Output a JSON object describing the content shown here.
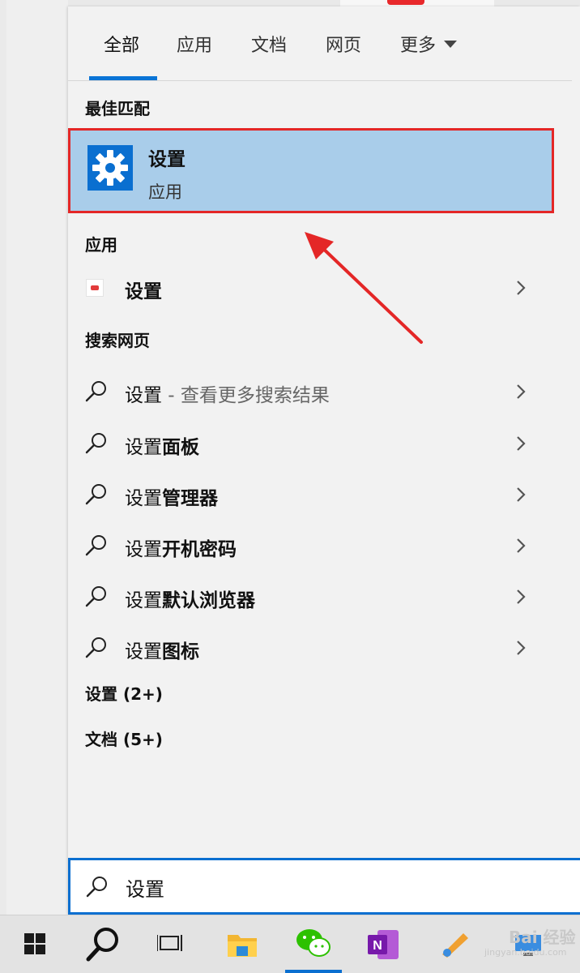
{
  "tabs": [
    {
      "label": "全部"
    },
    {
      "label": "应用"
    },
    {
      "label": "文档"
    },
    {
      "label": "网页"
    },
    {
      "label": "更多"
    }
  ],
  "sections": {
    "best_match": "最佳匹配",
    "apps": "应用",
    "web": "搜索网页",
    "settings_group": "设置 (2+)",
    "docs_group": "文档 (5+)"
  },
  "best_match": {
    "title": "设置",
    "subtitle": "应用"
  },
  "app_result": {
    "label": "设置"
  },
  "web_results": [
    {
      "prefix": "设置",
      "bold": "",
      "hint": " - 查看更多搜索结果"
    },
    {
      "prefix": "设置",
      "bold": "面板",
      "hint": ""
    },
    {
      "prefix": "设置",
      "bold": "管理器",
      "hint": ""
    },
    {
      "prefix": "设置",
      "bold": "开机密码",
      "hint": ""
    },
    {
      "prefix": "设置",
      "bold": "默认浏览器",
      "hint": ""
    },
    {
      "prefix": "设置",
      "bold": "图标",
      "hint": ""
    }
  ],
  "search": {
    "value": "设置"
  },
  "watermark": {
    "brand": "Bai 经验",
    "url": "jingyan.baidu.com"
  },
  "colors": {
    "accent": "#0a6fd0",
    "highlight": "#a9cdea",
    "annotation": "#e42727"
  }
}
